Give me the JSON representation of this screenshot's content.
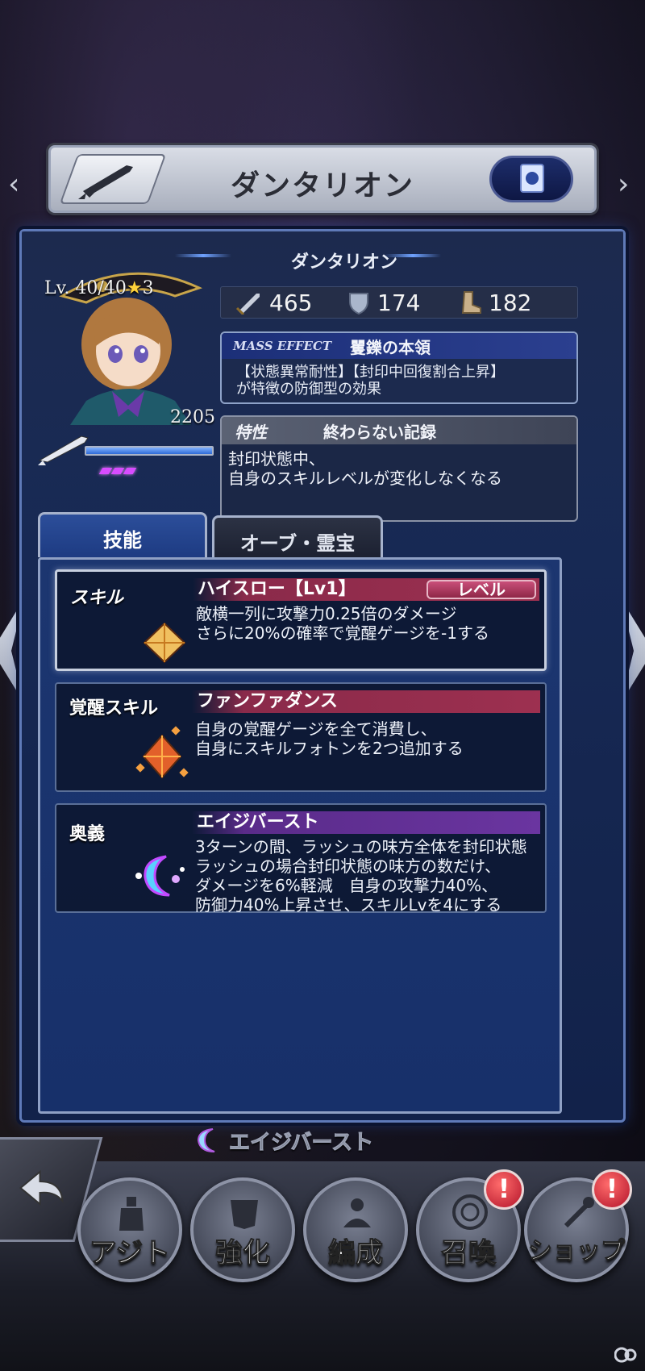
{
  "header": {
    "title": "ダンタリオン",
    "left_icon": "rifle-icon",
    "right_icon": "book-icon"
  },
  "character": {
    "name": "ダンタリオン",
    "level": "Lv. 40/40",
    "star": "★",
    "star_count": "3",
    "power": "2205",
    "hp_fraction": 1.0,
    "gauge_pips": 3
  },
  "stats": {
    "attack": "465",
    "defense": "174",
    "speed": "182"
  },
  "mass_effect": {
    "tag": "MASS EFFECT",
    "name": "矍鑠の本領",
    "desc_line1": "【状態異常耐性】【封印中回復割合上昇】",
    "desc_line2": "が特徴の防御型の効果"
  },
  "trait": {
    "tag": "特性",
    "name": "終わらない記録",
    "desc_line1": "封印状態中、",
    "desc_line2": "自身のスキルレベルが変化しなくなる"
  },
  "tabs": {
    "skills": "技能",
    "orb": "オーブ・霊宝"
  },
  "skills": [
    {
      "type": "スキル",
      "name": "ハイスロー【Lv1】",
      "level_button": "レベル",
      "lines": [
        "敵横一列に攻撃力0.25倍のダメージ",
        "さらに20%の確率で覚醒ゲージを-1する"
      ]
    },
    {
      "type": "覚醒スキル",
      "name": "ファンファダンス",
      "lines": [
        "自身の覚醒ゲージを全て消費し、",
        "自身にスキルフォトンを2つ追加する"
      ]
    },
    {
      "type": "奥義",
      "name": "エイジバースト",
      "lines": [
        "3ターンの間、ラッシュの味方全体を封印状態",
        "ラッシュの場合封印状態の味方の数だけ、",
        "ダメージを6%軽減　自身の攻撃力40%、",
        "防御力40%上昇させ、スキルLvを4にする"
      ]
    }
  ],
  "bottom": {
    "burst_label": "エイジバースト",
    "nav": [
      {
        "label": "アジト",
        "alert": false
      },
      {
        "label": "強化",
        "alert": false
      },
      {
        "label": "編成",
        "alert": false
      },
      {
        "label": "召喚",
        "alert": true,
        "alert_text": "!"
      },
      {
        "label": "ショップ",
        "alert": true,
        "alert_text": "!"
      }
    ]
  },
  "colors": {
    "panel": "#1a2d5a",
    "accent_blue": "#5f7ab8",
    "skill_red": "#9d3050",
    "ougi_purple": "#6a35a0",
    "alert_red": "#b3142a"
  }
}
